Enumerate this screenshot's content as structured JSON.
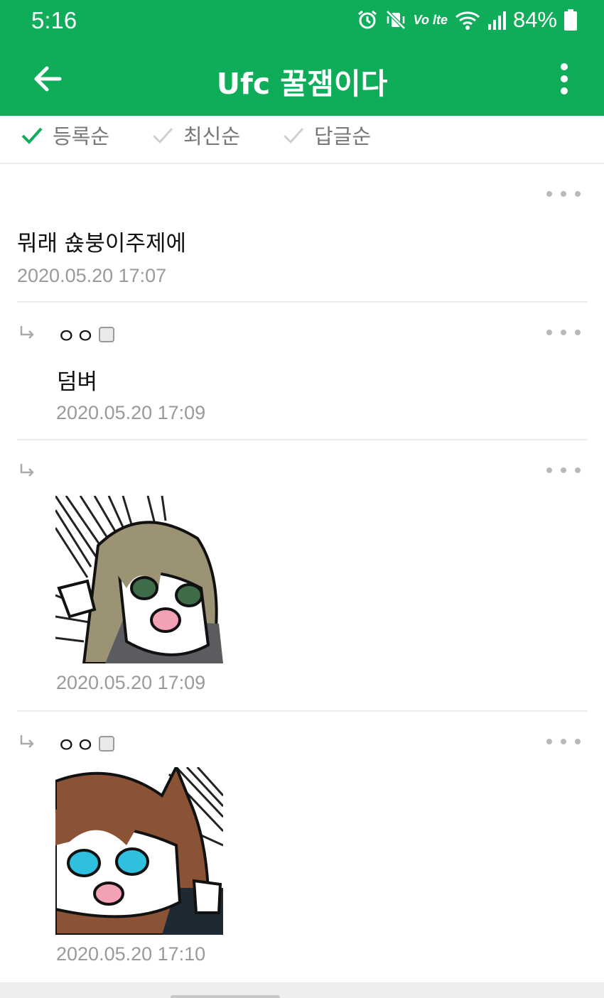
{
  "status_bar": {
    "time": "5:16",
    "lte_label": "Vo lte",
    "battery_percent": "84%"
  },
  "header": {
    "title": "Ufc 꿀잼이다",
    "back_icon": "arrow-left-icon",
    "more_icon": "vertical-dots-icon"
  },
  "sort_options": [
    {
      "label": "등록순",
      "selected": true
    },
    {
      "label": "최신순",
      "selected": false
    },
    {
      "label": "답글순",
      "selected": false
    }
  ],
  "comments": [
    {
      "is_reply": false,
      "nickname": "",
      "text": "뭐래 숁붕이주제에",
      "date": "2020.05.20 17:07"
    },
    {
      "is_reply": true,
      "nickname": "ㅇㅇ",
      "text": "덤벼",
      "date": "2020.05.20 17:09"
    },
    {
      "is_reply": true,
      "nickname": "",
      "sticker": "anime-girl-green-eyes-sticker",
      "date": "2020.05.20 17:09"
    },
    {
      "is_reply": true,
      "nickname": "ㅇㅇ",
      "sticker": "anime-girl-blue-eyes-sticker",
      "date": "2020.05.20 17:10"
    }
  ],
  "colors": {
    "brand_green": "#0fad5a",
    "date_gray": "#9a9a9a",
    "divider": "#ececec"
  }
}
